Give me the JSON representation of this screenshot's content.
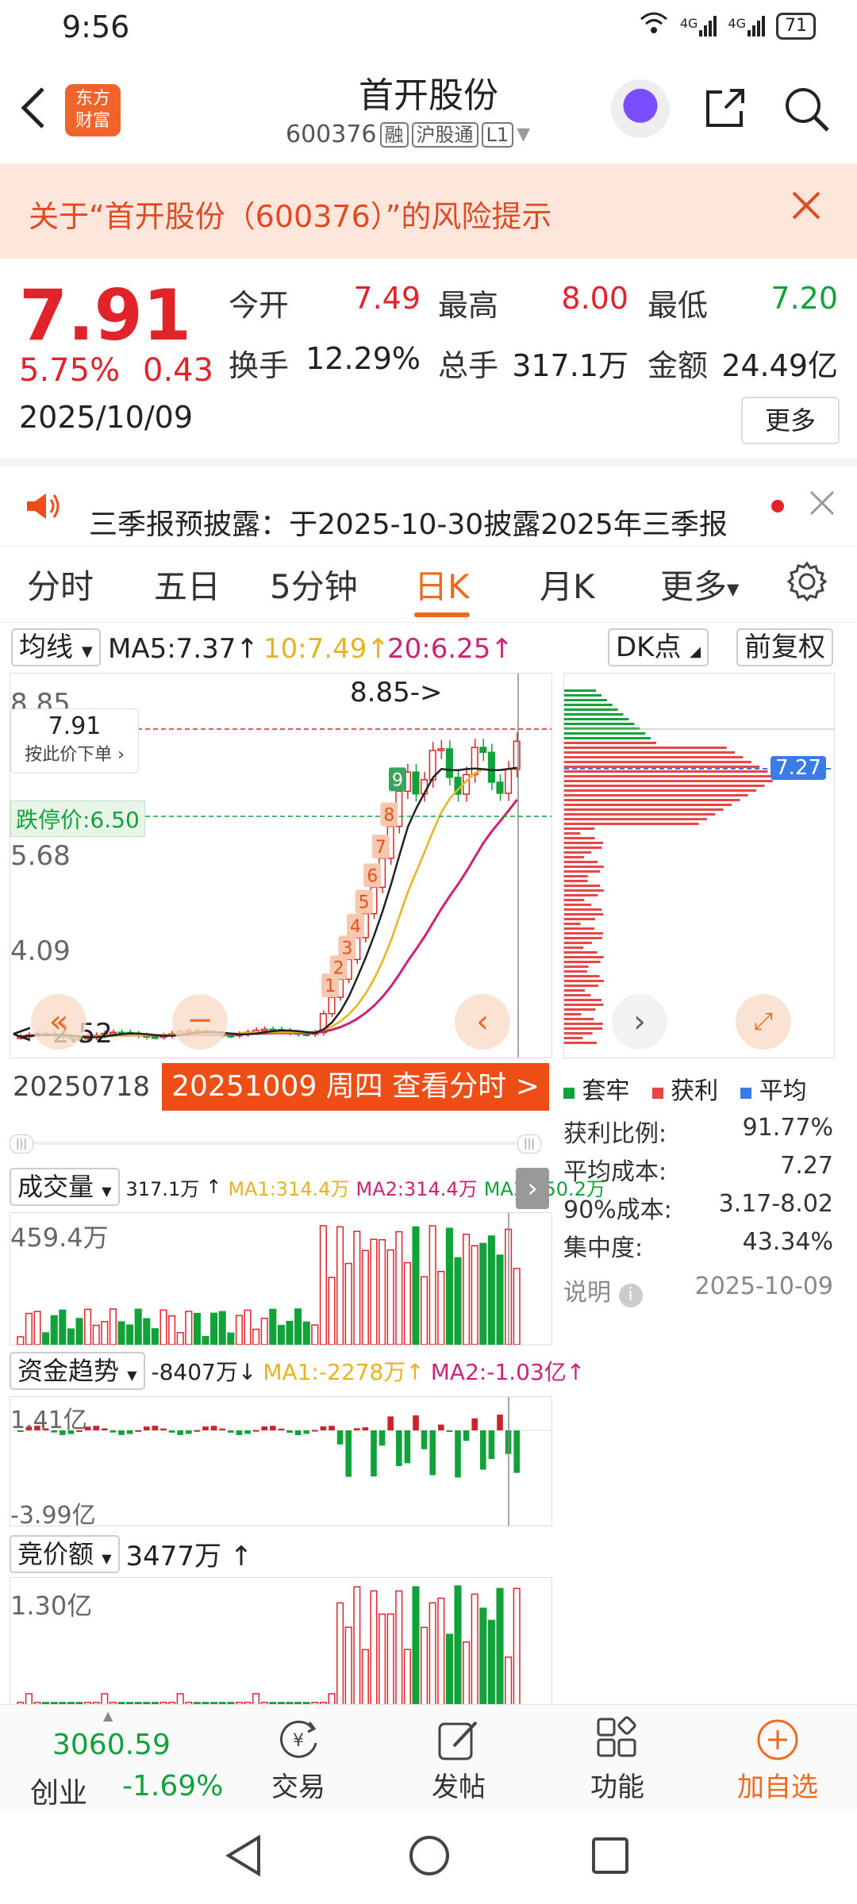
{
  "status": {
    "time": "9:56",
    "network": "4G",
    "battery": "71"
  },
  "header": {
    "logo_line1": "东方",
    "logo_line2": "财富",
    "stock_name": "首开股份",
    "stock_code": "600376",
    "tags": [
      "融",
      "沪股通",
      "L1"
    ]
  },
  "risk_banner": {
    "text": "关于“首开股份（600376）”的风险提示"
  },
  "quote": {
    "price": "7.91",
    "change_pct": "5.75%",
    "change": "0.43",
    "date": "2025/10/09",
    "open_label": "今开",
    "open": "7.49",
    "high_label": "最高",
    "high": "8.00",
    "low_label": "最低",
    "low": "7.20",
    "turnover_label": "换手",
    "turnover": "12.29%",
    "volume_label": "总手",
    "volume": "317.1万",
    "amount_label": "金额",
    "amount": "24.49亿",
    "more_label": "更多"
  },
  "notice": {
    "text": "三季报预披露：于2025-10-30披露2025年三季报"
  },
  "tabs": [
    {
      "label": "分时"
    },
    {
      "label": "五日"
    },
    {
      "label": "5分钟"
    },
    {
      "label": "日K"
    },
    {
      "label": "月K"
    },
    {
      "label": "更多"
    }
  ],
  "indicator": {
    "selector": "均线",
    "ma5": "MA5:7.37",
    "ma10": "10:7.49",
    "ma20": "20:6.25",
    "dk_label": "DK点",
    "fuquan_label": "前复权",
    "colors": {
      "ma5": "#222222",
      "ma10": "#e8b320",
      "ma20": "#cc2277"
    }
  },
  "kchart": {
    "price_labels": [
      "8.85",
      "5.68",
      "4.09"
    ],
    "max_marker": "8.85->",
    "min_marker": "<--2.52",
    "bubble_price": "7.91",
    "bubble_action": "按此价下单",
    "limit_down": "跌停价:6.50",
    "countdown": [
      "1",
      "2",
      "3",
      "4",
      "5",
      "6",
      "7",
      "8",
      "9"
    ],
    "start_date": "20250718",
    "selected_label": "20251009 周四  查看分时 >"
  },
  "chip": {
    "avg_label": "7.27",
    "legend": [
      "套牢",
      "获利",
      "平均"
    ],
    "legend_colors": [
      "#11a33a",
      "#e84545",
      "#3a7be8"
    ],
    "rows": [
      {
        "label": "获利比例:",
        "value": "91.77%"
      },
      {
        "label": "平均成本:",
        "value": "7.27"
      },
      {
        "label": "90%成本:",
        "value": "3.17-8.02"
      },
      {
        "label": "集中度:",
        "value": "43.34%"
      },
      {
        "label": "说明",
        "value": "2025-10-09"
      }
    ]
  },
  "volume": {
    "selector": "成交量",
    "meta_total": "317.1万",
    "meta_ma1": "MA1:314.4万",
    "meta_ma2": "MA2:314.4万",
    "meta_ma3": "MA3:150.2万",
    "max_label": "459.4万"
  },
  "fund": {
    "selector": "资金趋势",
    "value": "-8407万",
    "ma1": "MA1:-2278万",
    "ma2": "MA2:-1.03亿",
    "top_label": "1.41亿",
    "bottom_label": "-3.99亿"
  },
  "bid": {
    "selector": "竞价额",
    "value": "3477万",
    "top_label": "1.30亿"
  },
  "bottom_nav": {
    "index_value": "3060.59",
    "index_name": "创业",
    "index_change": "-1.69%",
    "items": [
      {
        "label": "交易"
      },
      {
        "label": "发帖"
      },
      {
        "label": "功能"
      },
      {
        "label": "加自选"
      }
    ]
  }
}
